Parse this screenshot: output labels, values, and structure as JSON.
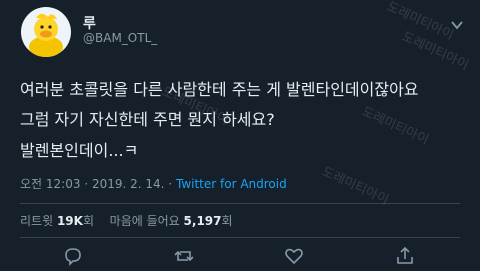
{
  "user": {
    "name": "루",
    "handle": "@BAM_OTL_"
  },
  "tweet": {
    "lines": [
      "여러분 초콜릿을 다른 사람한테 주는 게 발렌타인데이잖아요",
      "그럼 자기 자신한테 주면 뭔지 하세요?",
      "발렌본인데이...ㅋ"
    ]
  },
  "meta": {
    "time": "오전 12:03",
    "sep": "·",
    "date": "2019. 2. 14.",
    "source": "Twitter for Android"
  },
  "stats": {
    "retweets_label": "리트윗",
    "retweets_count": "19K",
    "retweets_unit": "회",
    "likes_label": "마음에 들어요",
    "likes_count": "5,197",
    "likes_unit": "회"
  },
  "watermark": "도레미티아이",
  "icons": [
    "chevron-down-icon",
    "reply-icon",
    "retweet-icon",
    "like-icon",
    "share-icon"
  ],
  "colors": {
    "background": "#15202b",
    "accent": "#1da1f2",
    "muted": "#8899a6",
    "text": "#e6ecf0",
    "divider": "#38444d"
  }
}
